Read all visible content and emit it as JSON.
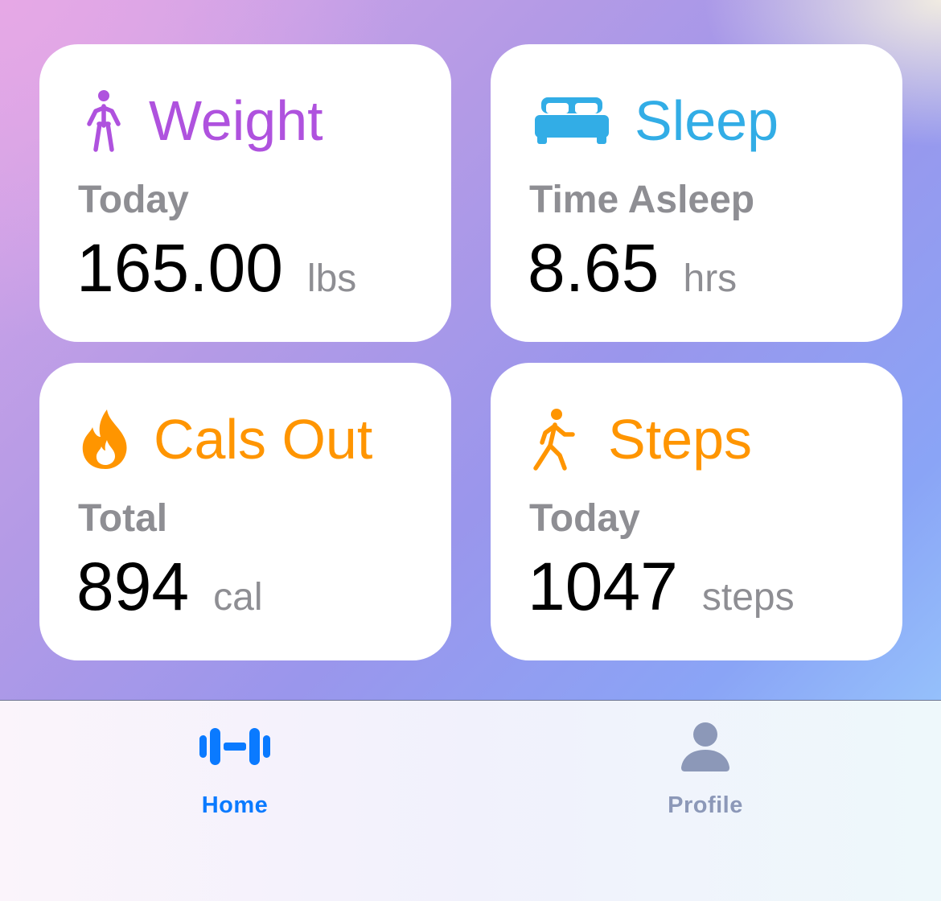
{
  "colors": {
    "weight": "#af52de",
    "sleep": "#32ade6",
    "orange": "#ff9500",
    "muted": "#8e8e93",
    "tab_active": "#0a7aff",
    "tab_inactive": "#8c98b8"
  },
  "cards": {
    "weight": {
      "icon": "person-standing-icon",
      "title": "Weight",
      "subtitle": "Today",
      "value": "165.00",
      "unit": "lbs"
    },
    "sleep": {
      "icon": "bed-icon",
      "title": "Sleep",
      "subtitle": "Time Asleep",
      "value": "8.65",
      "unit": "hrs"
    },
    "cals": {
      "icon": "flame-icon",
      "title": "Cals Out",
      "subtitle": "Total",
      "value": "894",
      "unit": "cal"
    },
    "steps": {
      "icon": "figure-walking-icon",
      "title": "Steps",
      "subtitle": "Today",
      "value": "1047",
      "unit": "steps"
    }
  },
  "tabbar": {
    "home": {
      "icon": "dumbbell-icon",
      "label": "Home",
      "selected": true
    },
    "profile": {
      "icon": "person-icon",
      "label": "Profile",
      "selected": false
    }
  }
}
